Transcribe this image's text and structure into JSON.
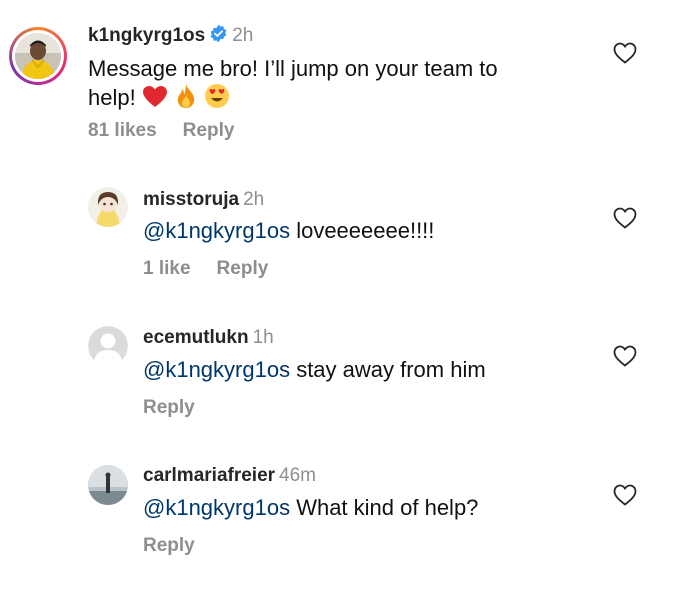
{
  "comments": [
    {
      "username": "k1ngkyrg1os",
      "verified": true,
      "time": "2h",
      "text_line1": "Message me bro! I’ll jump on your team to",
      "text_line2": "help!",
      "emojis": [
        "heart-emoji",
        "fire-emoji",
        "heart-eyes-emoji"
      ],
      "likes": "81 likes",
      "reply_label": "Reply"
    },
    {
      "username": "misstoruja",
      "time": "2h",
      "mention": "@k1ngkyrg1os",
      "text": " loveeeeeee!!!!",
      "likes": "1 like",
      "reply_label": "Reply"
    },
    {
      "username": "ecemutlukn",
      "time": "1h",
      "mention": "@k1ngkyrg1os",
      "text": " stay away from him",
      "reply_label": "Reply"
    },
    {
      "username": "carlmariafreier",
      "time": "46m",
      "mention": "@k1ngkyrg1os",
      "text": " What kind of help?",
      "reply_label": "Reply"
    }
  ],
  "colors": {
    "username": "#262626",
    "secondary": "#8e8e8e",
    "mention": "#00376b",
    "verified_badge": "#3897f0"
  },
  "icons": [
    "like-heart-icon",
    "verified-badge-icon"
  ]
}
